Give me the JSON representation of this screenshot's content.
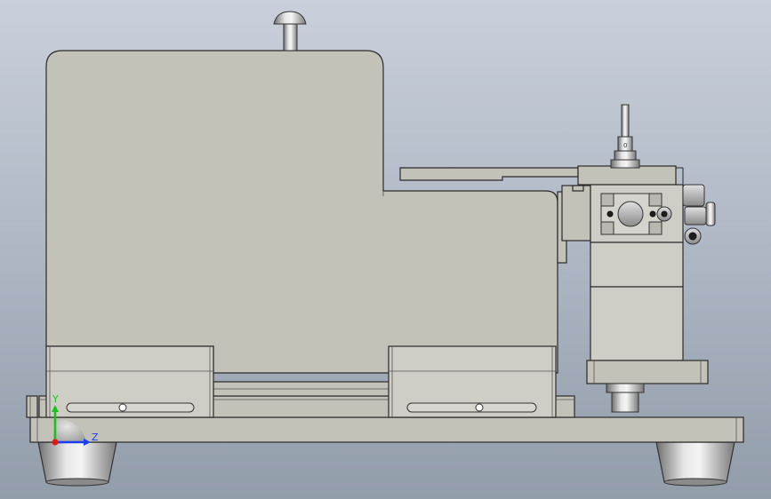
{
  "triad": {
    "y_label": "Y",
    "z_label": "Z",
    "y_color": "#17c417",
    "z_color": "#1c3cf0",
    "x_color": "#e01818"
  },
  "colors": {
    "background_top": "#c9d0db",
    "background_bottom": "#929daa",
    "part_fill": "#c3c2b9",
    "edge": "#2a2a2a",
    "metal_light": "#e6e6e6",
    "metal_dark": "#6f6f6f"
  }
}
